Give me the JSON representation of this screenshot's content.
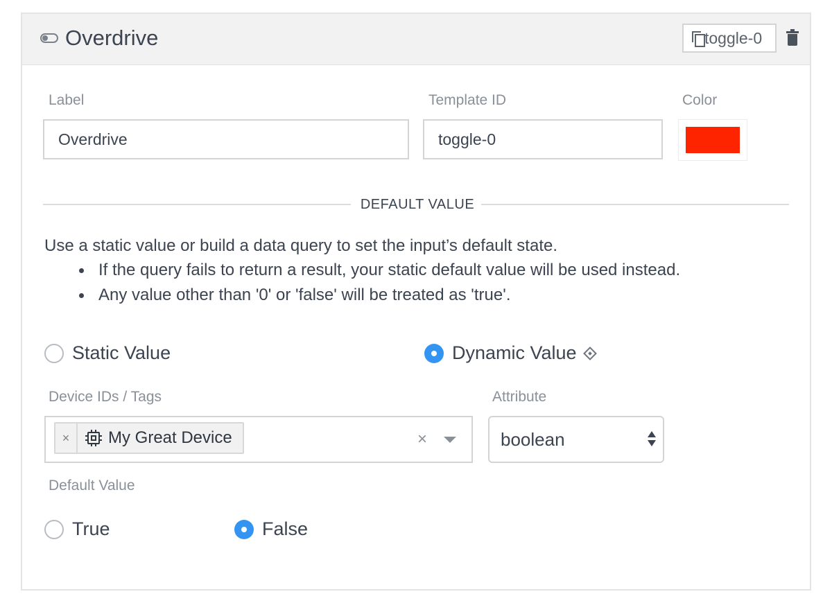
{
  "header": {
    "icon": "toggle-icon",
    "title": "Overdrive",
    "template_id_badge": "toggle-0"
  },
  "fields": {
    "label": {
      "label": "Label",
      "value": "Overdrive"
    },
    "template_id": {
      "label": "Template ID",
      "value": "toggle-0"
    },
    "color": {
      "label": "Color",
      "value": "#ff2400"
    }
  },
  "default_value_section": {
    "heading": "DEFAULT VALUE",
    "description": "Use a static value or build a data query to set the input’s default state.",
    "bullets": [
      "If the query fails to return a result, your static default value will be used instead.",
      "Any value other than '0' or 'false' will be treated as 'true'."
    ],
    "mode_options": {
      "static": {
        "label": "Static Value",
        "checked": false
      },
      "dynamic": {
        "label": "Dynamic Value",
        "checked": true
      }
    },
    "device_ids_tags": {
      "label": "Device IDs / Tags",
      "selected_tag": "My Great Device",
      "remove_glyph": "×",
      "clear_glyph": "×"
    },
    "attribute": {
      "label": "Attribute",
      "selected": "boolean"
    },
    "default_value": {
      "label": "Default Value",
      "options": {
        "true": {
          "label": "True",
          "checked": false
        },
        "false": {
          "label": "False",
          "checked": true
        }
      }
    }
  },
  "colors": {
    "accent": "#3395f1",
    "swatch": "#ff2400",
    "header_bg": "#f2f2f2"
  }
}
